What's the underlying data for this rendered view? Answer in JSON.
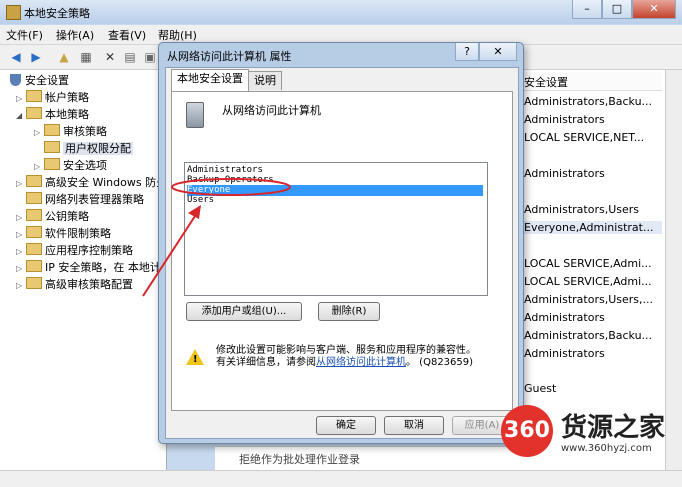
{
  "window": {
    "title": "本地安全策略",
    "buttons": {
      "min": "–",
      "max": "□",
      "close": "✕"
    }
  },
  "menu": [
    "文件(F)",
    "操作(A)",
    "查看(V)",
    "帮助(H)"
  ],
  "tree": {
    "root": "安全设置",
    "items": [
      {
        "label": "帐户策略",
        "exp": "▷"
      },
      {
        "label": "本地策略",
        "exp": "◢"
      },
      {
        "label": "审核策略",
        "exp": "▷"
      },
      {
        "label": "用户权限分配",
        "exp": ""
      },
      {
        "label": "安全选项",
        "exp": "▷"
      },
      {
        "label": "高级安全 Windows 防火",
        "exp": "▷"
      },
      {
        "label": "网络列表管理器策略",
        "exp": ""
      },
      {
        "label": "公钥策略",
        "exp": "▷"
      },
      {
        "label": "软件限制策略",
        "exp": "▷"
      },
      {
        "label": "应用程序控制策略",
        "exp": "▷"
      },
      {
        "label": "IP 安全策略，在 本地计",
        "exp": "▷"
      },
      {
        "label": "高级审核策略配置",
        "exp": "▷"
      }
    ]
  },
  "rightpane": {
    "header": "安全设置",
    "rows": [
      "Administrators,Backu...",
      "Administrators",
      "LOCAL SERVICE,NET...",
      "Administrators",
      "Administrators,Users",
      "Everyone,Administrat...",
      "LOCAL SERVICE,Admi...",
      "LOCAL SERVICE,Admi...",
      "Administrators,Users,...",
      "Administrators",
      "Administrators,Backu...",
      "Administrators",
      "Guest"
    ]
  },
  "bottompane": {
    "text": "拒绝作为批处理作业登录"
  },
  "dialog": {
    "title": "从网络访问此计算机 属性",
    "help_btn": "?",
    "close_btn": "✕",
    "tabs": [
      "本地安全设置",
      "说明"
    ],
    "policy_name": "从网络访问此计算机",
    "list": [
      "Administrators",
      "Backup Operators",
      "Everyone",
      "Users"
    ],
    "add_button": "添加用户或组(U)...",
    "remove_button": "删除(R)",
    "warning_line1": "修改此设置可能影响与客户端、服务和应用程序的兼容性。",
    "warning_prefix": "有关详细信息，请参阅",
    "warning_link": "从网络访问此计算机",
    "warning_suffix": "。 (Q823659)",
    "ok": "确定",
    "cancel": "取消",
    "apply": "应用(A)"
  },
  "watermark": {
    "disc": "360",
    "text": "货源之家",
    "url": "www.360hyzj.com"
  },
  "colors": {
    "highlight": "#3399ff",
    "annotation": "#d8262a",
    "brand": "#e2322b"
  }
}
